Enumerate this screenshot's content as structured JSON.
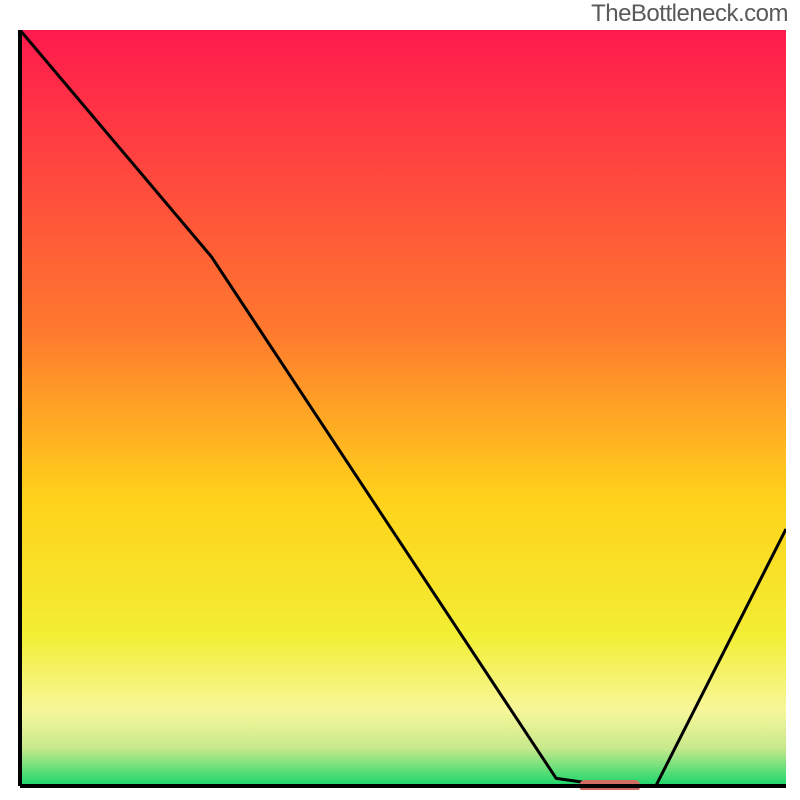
{
  "watermark": "TheBottleneck.com",
  "chart_data": {
    "type": "line",
    "title": "",
    "xlabel": "",
    "ylabel": "",
    "xlim": [
      0,
      100
    ],
    "ylim": [
      0,
      100
    ],
    "x": [
      0,
      25,
      70,
      77,
      83,
      100
    ],
    "values": [
      100,
      70,
      1,
      0,
      0,
      34
    ],
    "marker": {
      "x_range": [
        73,
        81
      ],
      "y": 0
    },
    "background_gradient": [
      {
        "offset": 0,
        "color": "#ff1a4d"
      },
      {
        "offset": 40,
        "color": "#ff7a2e"
      },
      {
        "offset": 62,
        "color": "#ffd21a"
      },
      {
        "offset": 80,
        "color": "#f2ee34"
      },
      {
        "offset": 90,
        "color": "#f7f79a"
      },
      {
        "offset": 95,
        "color": "#c7e98c"
      },
      {
        "offset": 100,
        "color": "#18d66b"
      }
    ],
    "line_color": "#000000",
    "axis_color": "#000000",
    "marker_color": "#d26d64"
  }
}
